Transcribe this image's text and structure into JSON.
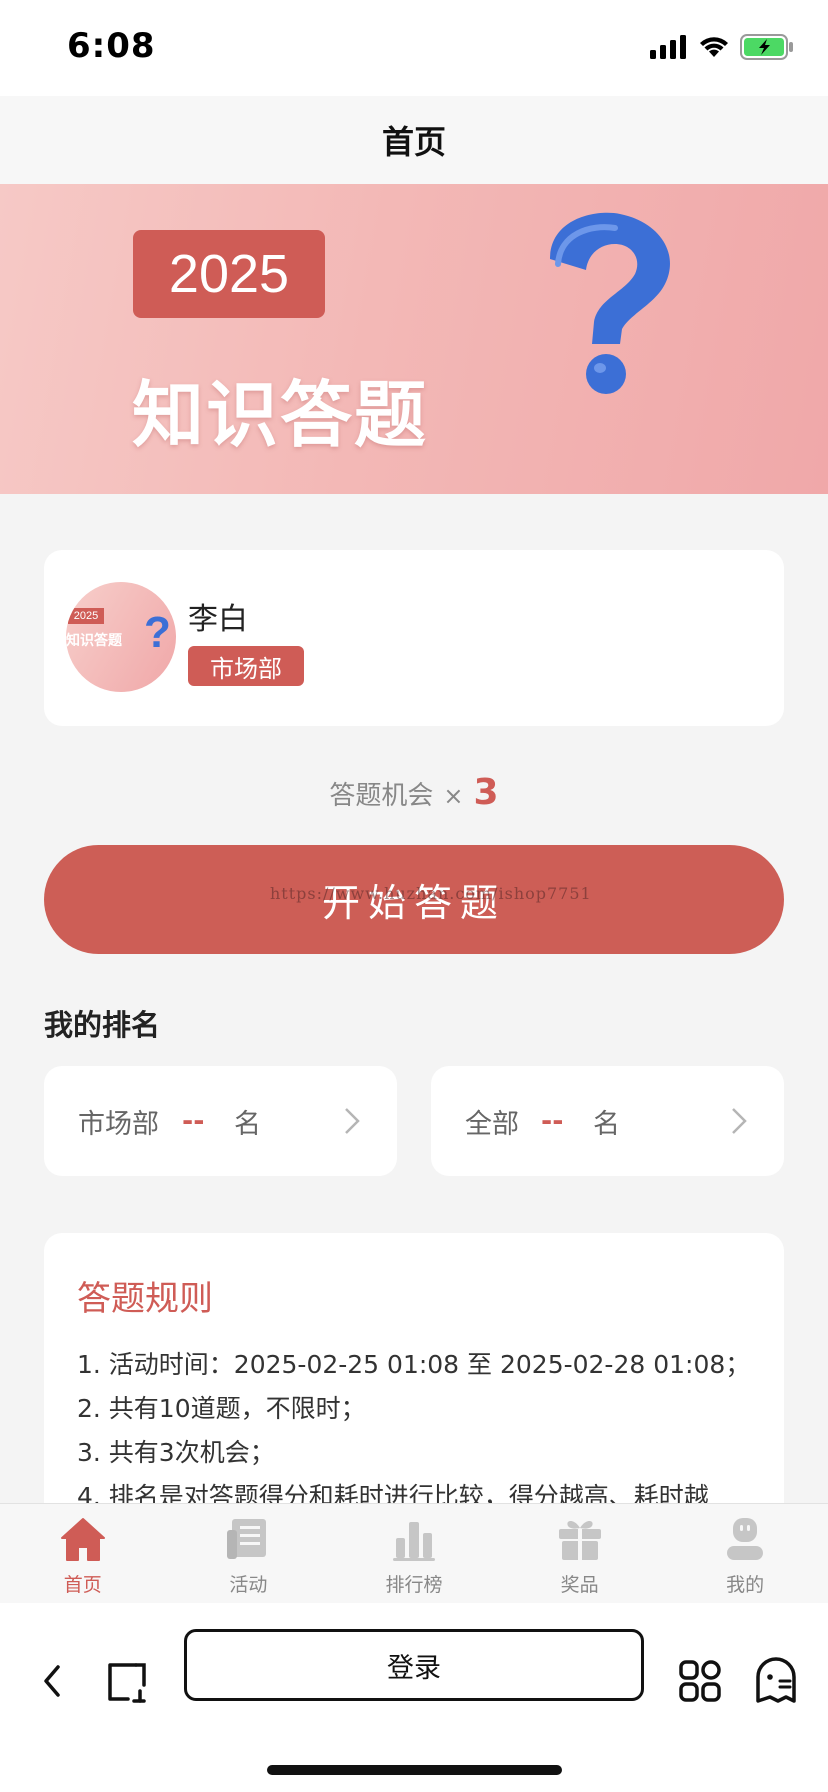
{
  "status_bar": {
    "time": "6:08"
  },
  "header": {
    "title": "首页"
  },
  "banner": {
    "year": "2025",
    "title": "知识答题"
  },
  "user": {
    "name": "李白",
    "department": "市场部",
    "avatar_year": "2025",
    "avatar_title": "知识答题"
  },
  "chances": {
    "label": "答题机会",
    "multiplier": "×",
    "count": "3"
  },
  "start_button": {
    "label": "开始答题"
  },
  "watermark": "https://www.huzhan.com/ishop7751",
  "ranking": {
    "title": "我的排名",
    "department": {
      "scope": "市场部",
      "value": "--",
      "unit": "名"
    },
    "overall": {
      "scope": "全部",
      "value": "--",
      "unit": "名"
    }
  },
  "rules": {
    "title": "答题规则",
    "items": [
      "1. 活动时间：2025-02-25 01:08 至 2025-02-28 01:08；",
      "2. 共有10道题，不限时；",
      "3. 共有3次机会；",
      "4. 排名是对答题得分和耗时进行比较，得分越高、耗时越"
    ]
  },
  "tab_bar": {
    "items": [
      {
        "label": "首页",
        "icon": "home-icon",
        "active": true
      },
      {
        "label": "活动",
        "icon": "news-icon",
        "active": false
      },
      {
        "label": "排行榜",
        "icon": "ranking-icon",
        "active": false
      },
      {
        "label": "奖品",
        "icon": "gift-icon",
        "active": false
      },
      {
        "label": "我的",
        "icon": "profile-icon",
        "active": false
      }
    ]
  },
  "browser_bar": {
    "login_label": "登录"
  },
  "colors": {
    "accent": "#cf5c56",
    "banner_pink": "#f3b8b6",
    "qmark_blue": "#3c6fd6"
  }
}
